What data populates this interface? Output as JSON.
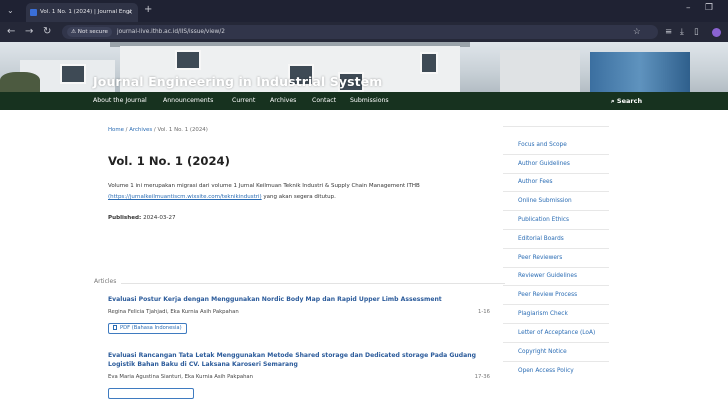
{
  "browser": {
    "tab_title": "Vol. 1 No. 1 (2024) | Journal Engi",
    "security_label": "Not secure",
    "url": "journal-live.ithb.ac.id/IIS/issue/view/2"
  },
  "site": {
    "title": "Journal Engineering in Industrial System",
    "nav": [
      "About the Journal",
      "Announcements",
      "Current",
      "Archives",
      "Contact",
      "Submissions"
    ],
    "search_label": "Search"
  },
  "breadcrumb": {
    "home": "Home",
    "sep1": "/",
    "archives": "Archives",
    "sep2": "/",
    "current": "Vol. 1 No. 1 (2024)"
  },
  "issue": {
    "title": "Vol. 1 No. 1 (2024)",
    "description": "Volume 1 ini merupakan migrasi dari volume 1 Jurnal Keilmuan Teknik Industri & Supply Chain Management ITHB",
    "link": "(https://jurnalkeilmuantiscm.wixsite.com/teknikindustri)",
    "description_tail": " yang akan segera ditutup.",
    "published_label": "Published:",
    "published_date": "2024-03-27"
  },
  "section_heading": "Articles",
  "articles": [
    {
      "title": "Evaluasi Postur Kerja dengan Menggunakan Nordic Body Map dan Rapid Upper Limb Assessment",
      "authors": "Regina Felicia Tjahjadi, Eka Kurnia Asih Pakpahan",
      "pages": "1-16",
      "pdf_label": "PDF (Bahasa Indonesia)"
    },
    {
      "title": "Evaluasi Rancangan Tata Letak Menggunakan Metode Shared storage dan Dedicated storage Pada Gudang Logistik Bahan Baku di CV. Laksana Karoseri Semarang",
      "authors": "Eva Maria Agustina Sianturi, Eka Kurnia Asih Pakpahan",
      "pages": "17-36"
    }
  ],
  "sidebar": [
    "Focus and Scope",
    "Author Guidelines",
    "Author Fees",
    "Online Submission",
    "Publication Ethics",
    "Editorial Boards",
    "Peer Reviewers",
    "Reviewer Guidelines",
    "Peer Review Process",
    "Plagiarism Check",
    "Letter of Acceptance (LoA)",
    "Copyright Notice",
    "Open Access Policy"
  ]
}
